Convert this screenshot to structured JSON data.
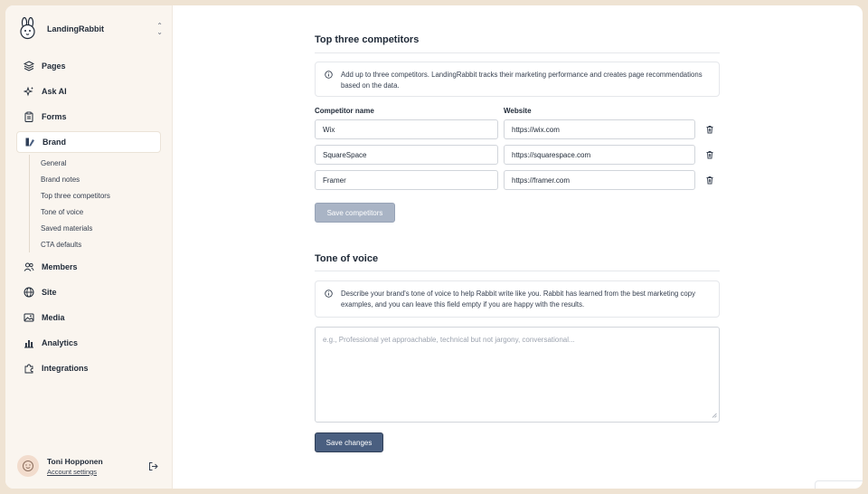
{
  "app": {
    "name": "LandingRabbit"
  },
  "sidebar": {
    "items": [
      {
        "label": "Pages",
        "icon": "layers-icon"
      },
      {
        "label": "Ask AI",
        "icon": "sparkles-icon"
      },
      {
        "label": "Forms",
        "icon": "clipboard-icon"
      },
      {
        "label": "Brand",
        "icon": "brand-icon",
        "active": true
      },
      {
        "label": "Members",
        "icon": "users-icon"
      },
      {
        "label": "Site",
        "icon": "globe-icon"
      },
      {
        "label": "Media",
        "icon": "image-icon"
      },
      {
        "label": "Analytics",
        "icon": "chart-icon"
      },
      {
        "label": "Integrations",
        "icon": "puzzle-icon"
      }
    ],
    "brand_subitems": [
      "General",
      "Brand notes",
      "Top three competitors",
      "Tone of voice",
      "Saved materials",
      "CTA defaults"
    ]
  },
  "user": {
    "name": "Toni Hopponen",
    "link": "Account settings"
  },
  "competitors": {
    "title": "Top three competitors",
    "info": "Add up to three competitors. LandingRabbit tracks their marketing performance and creates page recommendations based on the data.",
    "name_header": "Competitor name",
    "website_header": "Website",
    "rows": [
      {
        "name": "Wix",
        "website": "https://wix.com"
      },
      {
        "name": "SquareSpace",
        "website": "https://squarespace.com"
      },
      {
        "name": "Framer",
        "website": "https://framer.com"
      }
    ],
    "save_label": "Save competitors"
  },
  "tone": {
    "title": "Tone of voice",
    "info": "Describe your brand's tone of voice to help Rabbit write like you. Rabbit has learned from the best marketing copy examples, and you can leave this field empty if you are happy with the results.",
    "placeholder": "e.g., Professional yet approachable, technical but not jargony, conversational...",
    "save_label": "Save changes"
  },
  "colors": {
    "primary": "#4a5f80",
    "disabled": "#a9b4c5",
    "sidebar_bg": "#faf5ef",
    "outer_bg": "#efe3d3"
  }
}
